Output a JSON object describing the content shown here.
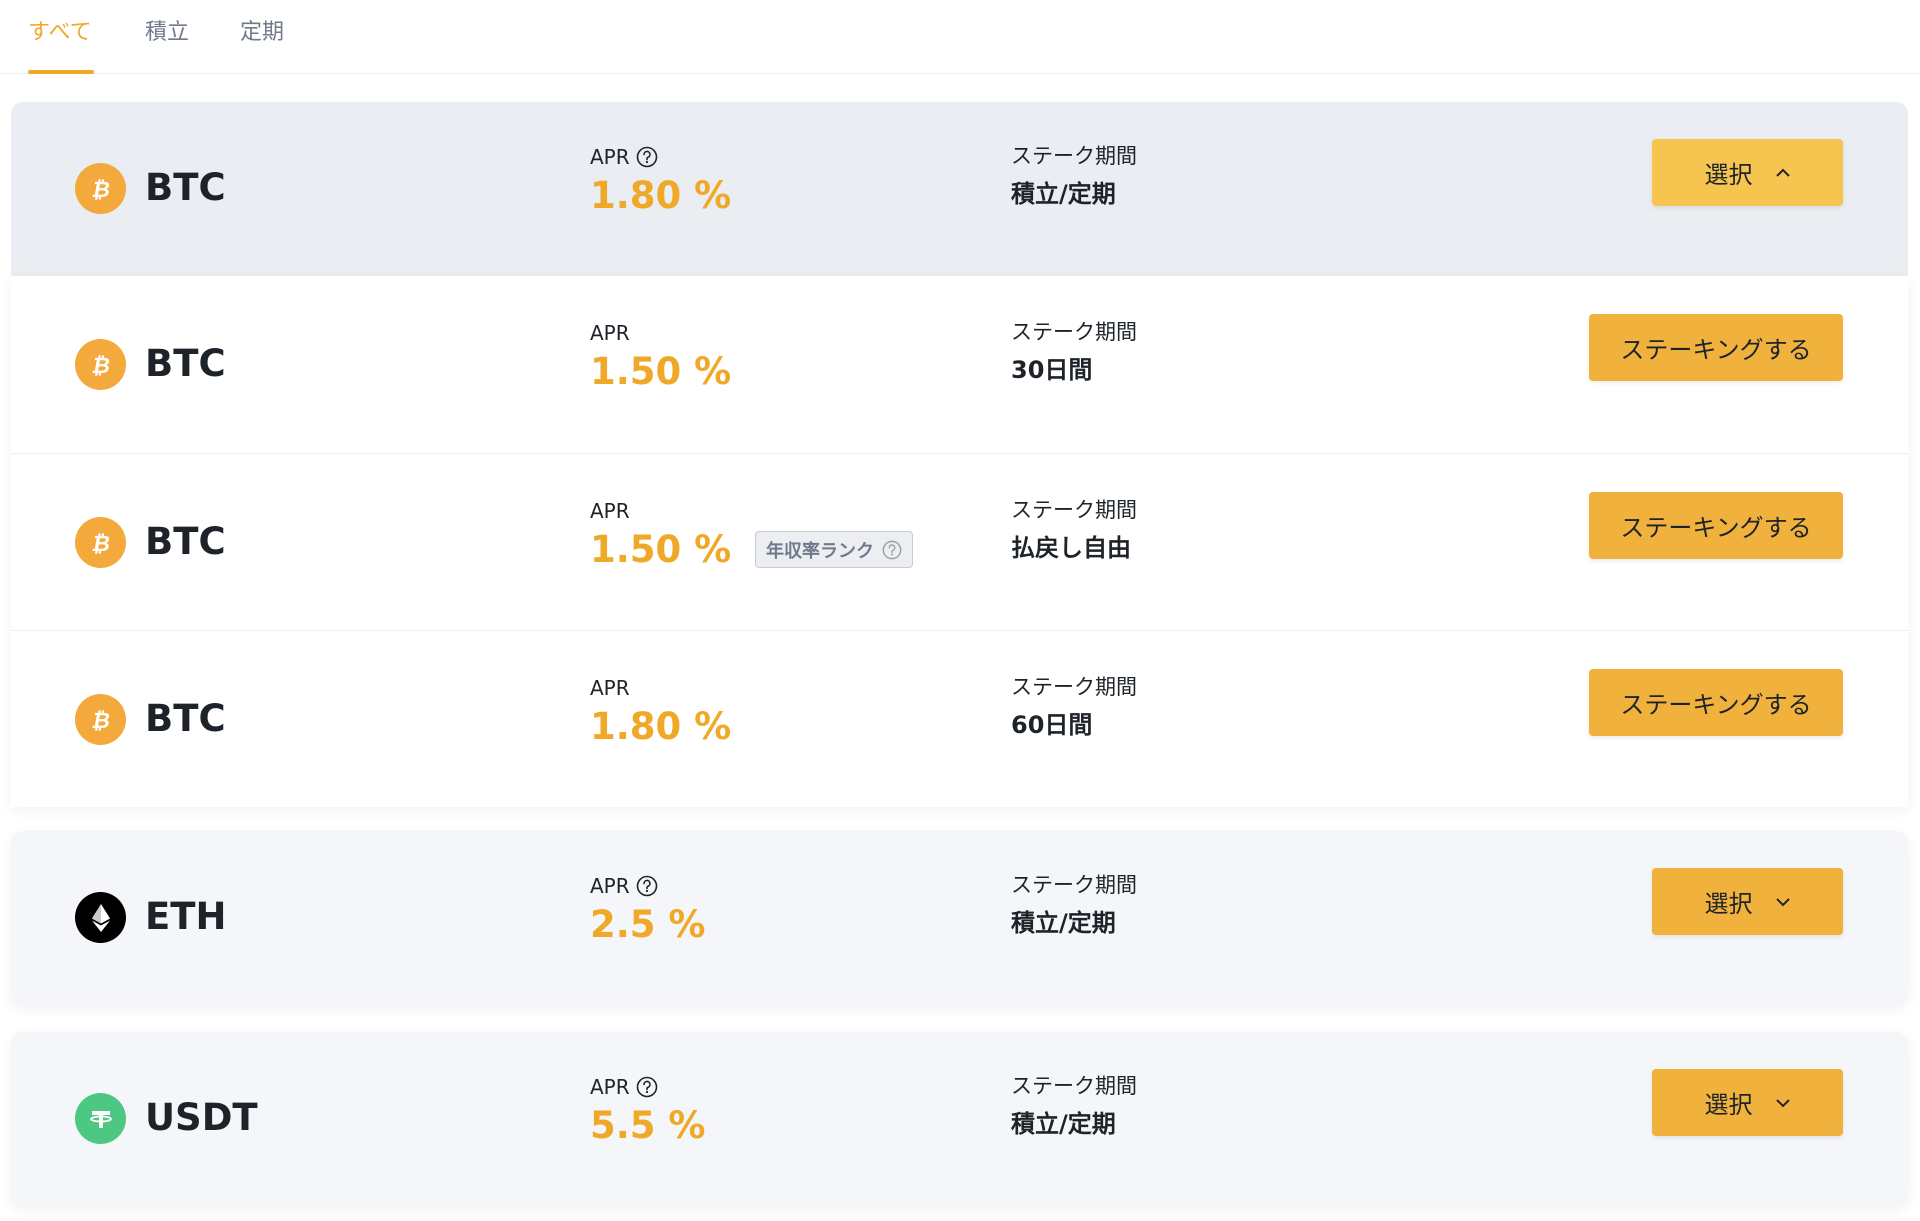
{
  "tabs": [
    {
      "label": "すべて",
      "active": true
    },
    {
      "label": "積立",
      "active": false
    },
    {
      "label": "定期",
      "active": false
    }
  ],
  "colors": {
    "accent": "#f0a829",
    "button": "#f0b23c",
    "btc": "#f3a93b",
    "eth": "#000000",
    "usdt": "#4dc883"
  },
  "products": [
    {
      "coin": "BTC",
      "icon": "btc-icon",
      "apr_label": "APR",
      "apr": "1.80 %",
      "term_label": "ステーク期間",
      "term": "積立/定期",
      "button": "選択",
      "expanded": true,
      "options": [
        {
          "coin": "BTC",
          "apr_label": "APR",
          "apr": "1.50 %",
          "term_label": "ステーク期間",
          "term": "30日間",
          "button": "ステーキングする"
        },
        {
          "coin": "BTC",
          "apr_label": "APR",
          "apr": "1.50 %",
          "badge": "年収率ランク",
          "term_label": "ステーク期間",
          "term": "払戻し自由",
          "button": "ステーキングする"
        },
        {
          "coin": "BTC",
          "apr_label": "APR",
          "apr": "1.80 %",
          "term_label": "ステーク期間",
          "term": "60日間",
          "button": "ステーキングする"
        }
      ]
    },
    {
      "coin": "ETH",
      "icon": "eth-icon",
      "apr_label": "APR",
      "apr": "2.5 %",
      "term_label": "ステーク期間",
      "term": "積立/定期",
      "button": "選択",
      "expanded": false
    },
    {
      "coin": "USDT",
      "icon": "usdt-icon",
      "apr_label": "APR",
      "apr": "5.5 %",
      "term_label": "ステーク期間",
      "term": "積立/定期",
      "button": "選択",
      "expanded": false
    }
  ]
}
